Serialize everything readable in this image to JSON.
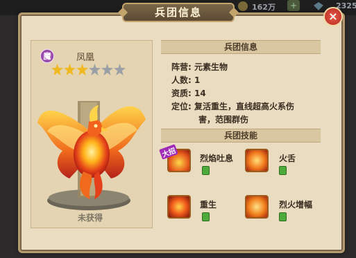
{
  "topbar": {
    "gold_amount": "162万",
    "plus_label": "+",
    "gem_amount": "2325"
  },
  "panel": {
    "title": "兵团信息",
    "close_label": "×"
  },
  "unit": {
    "faction_badge": "魔",
    "name": "凤凰",
    "stars_filled": 3,
    "stars_total": 6,
    "status": "未获得"
  },
  "info": {
    "header": "兵团信息",
    "camp": "阵营: 元素生物",
    "count": "人数: 1",
    "aptitude": "资质: 14",
    "role_line1": "定位: 复活重生，直线超高火系伤",
    "role_line2": "害，范围群伤"
  },
  "skills": {
    "header": "兵团技能",
    "ultimate_tag": "大招",
    "items": [
      {
        "name": "烈焰吐息"
      },
      {
        "name": "火舌"
      },
      {
        "name": "重生"
      },
      {
        "name": "烈火增幅"
      }
    ]
  },
  "colors": {
    "panel_bg": "#e9dcc0",
    "accent_gold": "#f0b821",
    "close_red": "#d2402f"
  }
}
